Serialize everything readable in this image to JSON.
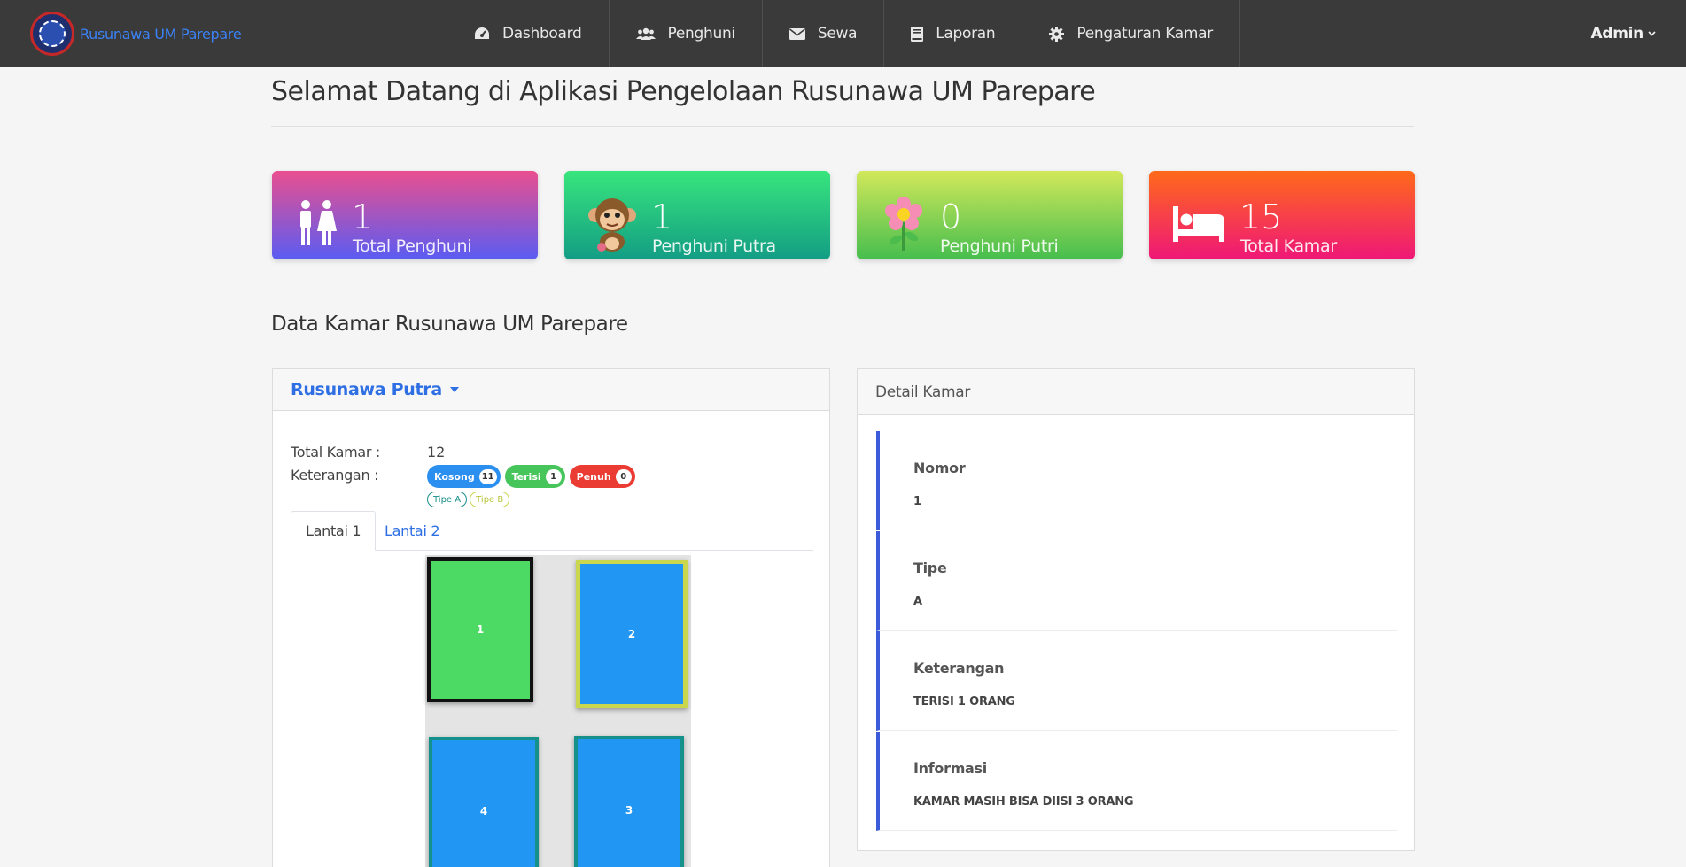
{
  "navbar": {
    "brand": "Rusunawa UM Parepare",
    "menu": [
      {
        "label": "Dashboard",
        "icon": "dashboard-icon"
      },
      {
        "label": "Penghuni",
        "icon": "users-icon"
      },
      {
        "label": "Sewa",
        "icon": "envelope-icon"
      },
      {
        "label": "Laporan",
        "icon": "book-icon"
      },
      {
        "label": "Pengaturan Kamar",
        "icon": "gear-icon"
      }
    ],
    "user": "Admin"
  },
  "page": {
    "title": "Selamat Datang di Aplikasi Pengelolaan Rusunawa UM Parepare",
    "section_title": "Data Kamar Rusunawa UM Parepare"
  },
  "stats": [
    {
      "value": "1",
      "label": "Total Penghuni",
      "icon": "restroom-icon"
    },
    {
      "value": "1",
      "label": "Penghuni Putra",
      "icon": "monkey-icon"
    },
    {
      "value": "0",
      "label": "Penghuni Putri",
      "icon": "flower-icon"
    },
    {
      "value": "15",
      "label": "Total Kamar",
      "icon": "bed-icon"
    }
  ],
  "rooms_panel": {
    "dropdown": "Rusunawa Putra",
    "total_label": "Total Kamar :",
    "total_value": "12",
    "keterangan_label": "Keterangan :",
    "status_badges": [
      {
        "label": "Kosong",
        "count": "11",
        "color": "#2b8ff0"
      },
      {
        "label": "Terisi",
        "count": "1",
        "color": "#46c65a"
      },
      {
        "label": "Penuh",
        "count": "0",
        "color": "#ea3c33"
      }
    ],
    "type_badges": [
      "Tipe A",
      "Tipe B"
    ],
    "tabs": [
      "Lantai 1",
      "Lantai 2"
    ],
    "active_tab": "Lantai 1",
    "rooms": [
      {
        "number": "1",
        "status": "terisi",
        "type": "A",
        "selected": true
      },
      {
        "number": "2",
        "status": "kosong",
        "type": "B"
      },
      {
        "number": "4",
        "status": "kosong",
        "type": "A"
      },
      {
        "number": "3",
        "status": "kosong",
        "type": "A"
      }
    ]
  },
  "detail_panel": {
    "title": "Detail Kamar",
    "fields": [
      {
        "label": "Nomor",
        "value": "1"
      },
      {
        "label": "Tipe",
        "value": "A"
      },
      {
        "label": "Keterangan",
        "value": "TERISI 1 ORANG"
      },
      {
        "label": "Informasi",
        "value": "KAMAR MASIH BISA DIISI 3 ORANG"
      }
    ]
  },
  "colors": {
    "navbar": "#3a3a3a",
    "accent": "#2f6fe4",
    "room_empty": "#2196f3",
    "room_filled": "#4cd964",
    "type_a_border": "#16908a",
    "type_b_border": "#cbd64f"
  }
}
